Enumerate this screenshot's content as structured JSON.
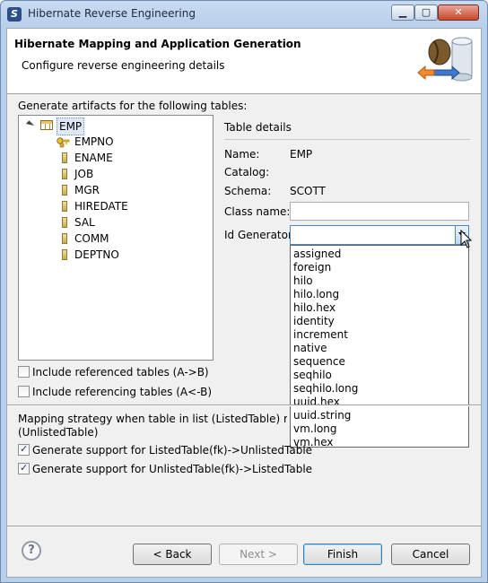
{
  "window": {
    "title": "Hibernate Reverse Engineering"
  },
  "banner": {
    "title": "Hibernate Mapping and Application Generation",
    "subtitle": "Configure reverse engineering details"
  },
  "tables": {
    "label": "Generate artifacts for the following tables:",
    "root": "EMP",
    "columns": [
      "EMPNO",
      "ENAME",
      "JOB",
      "MGR",
      "HIREDATE",
      "SAL",
      "COMM",
      "DEPTNO"
    ],
    "primary_key_column": "EMPNO"
  },
  "details": {
    "heading": "Table details",
    "name_label": "Name:",
    "name_value": "EMP",
    "catalog_label": "Catalog:",
    "catalog_value": "",
    "schema_label": "Schema:",
    "schema_value": "SCOTT",
    "class_name_label": "Class name:",
    "class_name_value": "",
    "id_generator_label": "Id Generator:",
    "id_generator_value": ""
  },
  "id_generator_options": [
    "assigned",
    "foreign",
    "hilo",
    "hilo.long",
    "hilo.hex",
    "identity",
    "increment",
    "native",
    "sequence",
    "seqhilo",
    "seqhilo.long",
    "uuid.hex",
    "uuid.string",
    "vm.long",
    "vm.hex"
  ],
  "options": {
    "include_referenced": {
      "label": "Include referenced tables (A->B)",
      "checked": false
    },
    "include_referencing": {
      "label": "Include referencing tables (A<-B)",
      "checked": false
    }
  },
  "mapping": {
    "line1": "Mapping strategy when table in list (ListedTable) references a table not in list",
    "line2": "(UnlistedTable)",
    "listed_to_unlisted": {
      "label": "Generate support for ListedTable(fk)->UnlistedTable",
      "checked": true
    },
    "unlisted_to_listed": {
      "label": "Generate support for UnlistedTable(fk)->ListedTable",
      "checked": true
    }
  },
  "buttons": {
    "help": "?",
    "back": "< Back",
    "next": "Next >",
    "finish": "Finish",
    "cancel": "Cancel"
  },
  "colors": {
    "title_bar": "#b9cfea",
    "dialog_bg": "#f0f0f0",
    "close_button": "#c7472c",
    "focus_border": "#4f86c4"
  }
}
